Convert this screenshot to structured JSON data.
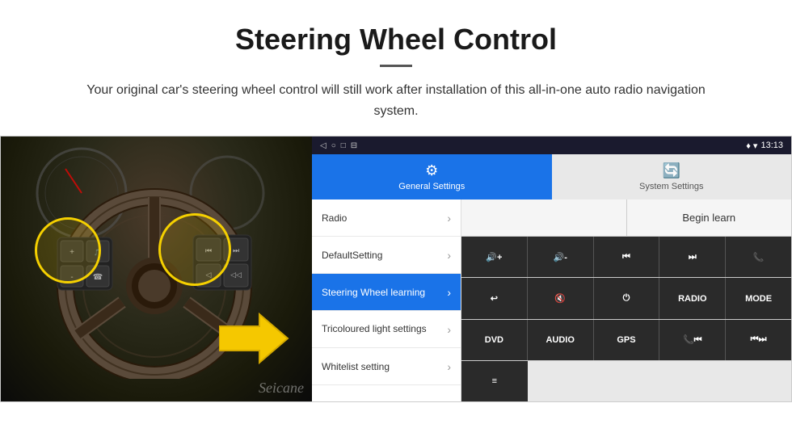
{
  "header": {
    "title": "Steering Wheel Control",
    "subtitle": "Your original car's steering wheel control will still work after installation of this all-in-one auto radio navigation system."
  },
  "status_bar": {
    "icons": [
      "◁",
      "○",
      "□",
      "⊟"
    ],
    "right_icons": "♦ ▾",
    "time": "13:13"
  },
  "tabs": [
    {
      "label": "General Settings",
      "icon": "⚙",
      "active": true
    },
    {
      "label": "System Settings",
      "icon": "🔄",
      "active": false
    }
  ],
  "menu": {
    "items": [
      {
        "label": "Radio",
        "active": false
      },
      {
        "label": "DefaultSetting",
        "active": false
      },
      {
        "label": "Steering Wheel learning",
        "active": true
      },
      {
        "label": "Tricoloured light settings",
        "active": false
      },
      {
        "label": "Whitelist setting",
        "active": false
      }
    ]
  },
  "right_panel": {
    "begin_learn_label": "Begin learn",
    "button_rows": [
      [
        {
          "label": "🔊+",
          "type": "icon"
        },
        {
          "label": "🔊-",
          "type": "icon"
        },
        {
          "label": "⏮",
          "type": "icon"
        },
        {
          "label": "⏭",
          "type": "icon"
        },
        {
          "label": "📞",
          "type": "icon"
        }
      ],
      [
        {
          "label": "↩",
          "type": "icon"
        },
        {
          "label": "🔇",
          "type": "icon"
        },
        {
          "label": "⏻",
          "type": "icon"
        },
        {
          "label": "RADIO",
          "type": "text"
        },
        {
          "label": "MODE",
          "type": "text"
        }
      ],
      [
        {
          "label": "DVD",
          "type": "text"
        },
        {
          "label": "AUDIO",
          "type": "text"
        },
        {
          "label": "GPS",
          "type": "text"
        },
        {
          "label": "📞⏮",
          "type": "icon"
        },
        {
          "label": "⏮⏭",
          "type": "icon"
        }
      ],
      [
        {
          "label": "≡",
          "type": "icon_single"
        }
      ]
    ]
  },
  "watermark": "Seicane"
}
